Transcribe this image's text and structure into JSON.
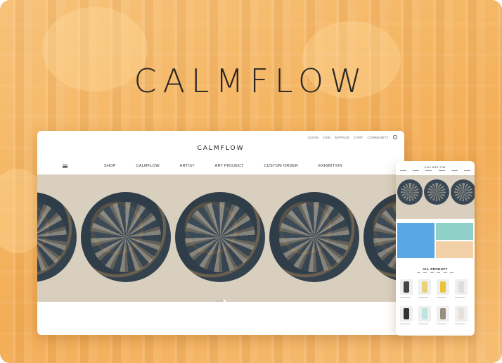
{
  "brand": {
    "hero_logo": "CALMFLOW",
    "site_logo": "CALMFLOW"
  },
  "utility_links": [
    "LOGIN",
    "JOIN",
    "MYPAGE",
    "CART",
    "COMMUNITY"
  ],
  "nav": [
    "SHOP",
    "CALMFLOW",
    "ARTIST",
    "ART PROJECT",
    "CUSTOM ORDER",
    "EXHIBITION"
  ],
  "mobile": {
    "logo": "CALMFLOW",
    "section_title": "ALL PRODUCT"
  },
  "colors": {
    "background": "#f5b765",
    "text": "#2a2622",
    "hero_bg": "#d8cfbf",
    "circle": "#3a4855"
  },
  "icons": {
    "search": "search-icon",
    "menu": "hamburger-menu-icon"
  }
}
